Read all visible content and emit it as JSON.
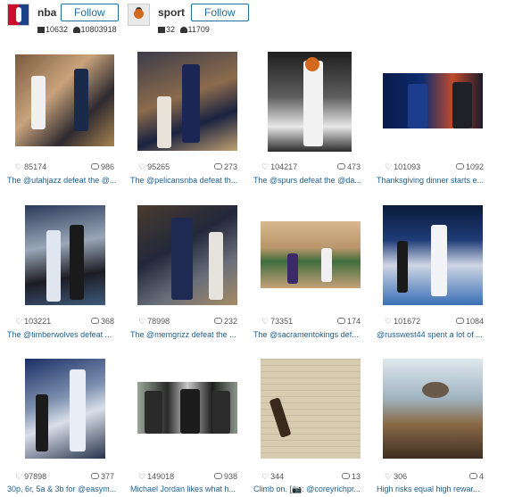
{
  "profiles": [
    {
      "name": "nba",
      "follow_label": "Follow",
      "posts": "10632",
      "followers": "10803918",
      "avatar_icon": "nba-logo-icon"
    },
    {
      "name": "sport",
      "follow_label": "Follow",
      "posts": "32",
      "followers": "11709",
      "avatar_icon": "basketball-icon"
    }
  ],
  "posts": [
    {
      "likes": "85174",
      "comments": "986",
      "caption": "The @utahjazz defeat the @..."
    },
    {
      "likes": "95265",
      "comments": "273",
      "caption": "The @pelicansnba defeat th..."
    },
    {
      "likes": "104217",
      "comments": "473",
      "caption": "The @spurs defeat the @da..."
    },
    {
      "likes": "101093",
      "comments": "1092",
      "caption": "Thanksgiving dinner starts e..."
    },
    {
      "likes": "103221",
      "comments": "368",
      "caption": "The @timberwolves defeat ..."
    },
    {
      "likes": "78998",
      "comments": "232",
      "caption": "The @memgrizz defeat the ..."
    },
    {
      "likes": "73351",
      "comments": "174",
      "caption": "The @sacramentokings def..."
    },
    {
      "likes": "101672",
      "comments": "1084",
      "caption": "@russwest44 spent a lot of ..."
    },
    {
      "likes": "97898",
      "comments": "377",
      "caption": "30p, 6r, 5a & 3b for @easym..."
    },
    {
      "likes": "149018",
      "comments": "938",
      "caption": "Michael Jordan likes what h..."
    },
    {
      "likes": "344",
      "comments": "13",
      "caption": "Climb on. [📷: @coreyrichpr..."
    },
    {
      "likes": "306",
      "comments": "4",
      "caption": "High risks equal high rewar..."
    }
  ],
  "icons": {
    "like": "heart-icon",
    "comment": "comment-icon",
    "posts": "camera-icon",
    "followers": "user-icon"
  },
  "colors": {
    "link": "#1f5f8f",
    "follow_border": "#1f6fa0"
  }
}
